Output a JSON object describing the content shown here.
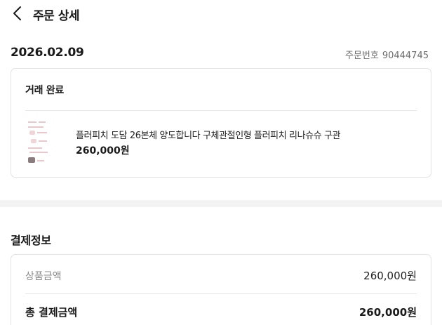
{
  "header": {
    "title": "주문 상세",
    "back_icon": "chevron-left-icon"
  },
  "order": {
    "date": "2026.02.09",
    "number_label": "주문번호",
    "number": "90444745"
  },
  "order_card": {
    "status": "거래 완료",
    "product": {
      "title": "플러피치 도담 26본체 양도합니다 구체관절인형 플러피치 리나슈슈 구관",
      "price": "260,000원"
    }
  },
  "payment": {
    "section_title": "결제정보",
    "rows": [
      {
        "label": "상품금액",
        "value": "260,000원"
      }
    ],
    "total": {
      "label": "총 결제금액",
      "value": "260,000원"
    }
  }
}
